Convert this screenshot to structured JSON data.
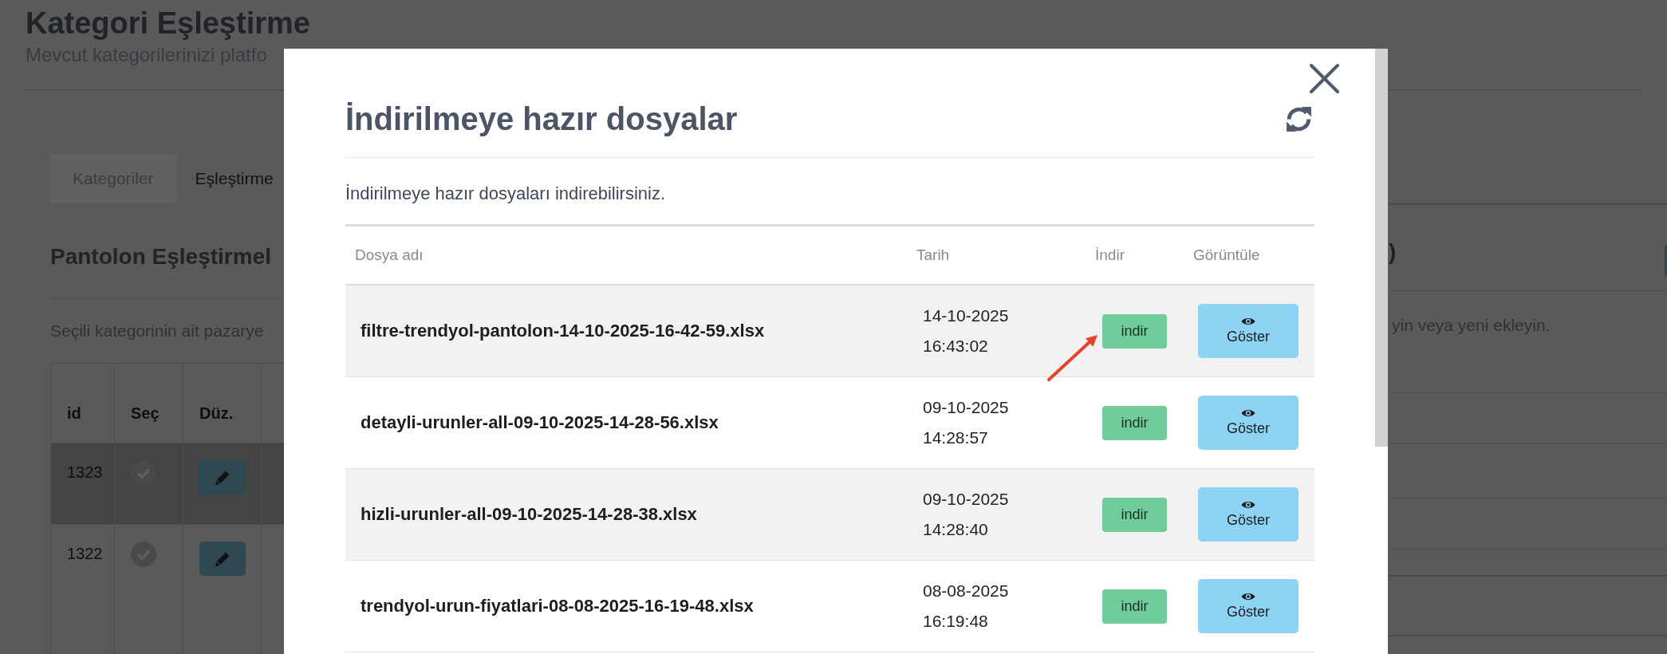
{
  "page": {
    "title": "Kategori Eşleştirme",
    "subtitle": "Mevcut kategorilerinizi platfo"
  },
  "tabs": [
    {
      "label": "Kategoriler",
      "selected": false
    },
    {
      "label": "Eşleştirme",
      "selected": true
    }
  ],
  "mapping_panel": {
    "heading": "Pantolon Eşleştirmel",
    "description": "Seçili kategorinin ait pazarye",
    "columns": [
      "id",
      "Seç",
      "Düz."
    ],
    "rows": [
      {
        "id": "1323",
        "selected": true
      },
      {
        "id": "1322",
        "selected": false
      }
    ]
  },
  "right_panel": {
    "heading": ")",
    "description": "yin veya yeni ekleyin."
  },
  "modal": {
    "title": "İndirilmeye hazır dosyalar",
    "description": "İndirilmeye hazır dosyaları indirebilirsiniz.",
    "columns": [
      "Dosya adı",
      "Tarih",
      "İndir",
      "Görüntüle"
    ],
    "rows": [
      {
        "file_name": "filtre-trendyol-pantolon-14-10-2025-16-42-59.xlsx",
        "date": "14-10-2025 16:43:02",
        "download_label": "indir",
        "view_label": "Göster"
      },
      {
        "file_name": "detayli-urunler-all-09-10-2025-14-28-56.xlsx",
        "date": "09-10-2025 14:28:57",
        "download_label": "indir",
        "view_label": "Göster"
      },
      {
        "file_name": "hizli-urunler-all-09-10-2025-14-28-38.xlsx",
        "date": "09-10-2025 14:28:40",
        "download_label": "indir",
        "view_label": "Göster"
      },
      {
        "file_name": "trendyol-urun-fiyatlari-08-08-2025-16-19-48.xlsx",
        "date": "08-08-2025 16:19:48",
        "download_label": "indir",
        "view_label": "Göster"
      }
    ]
  }
}
